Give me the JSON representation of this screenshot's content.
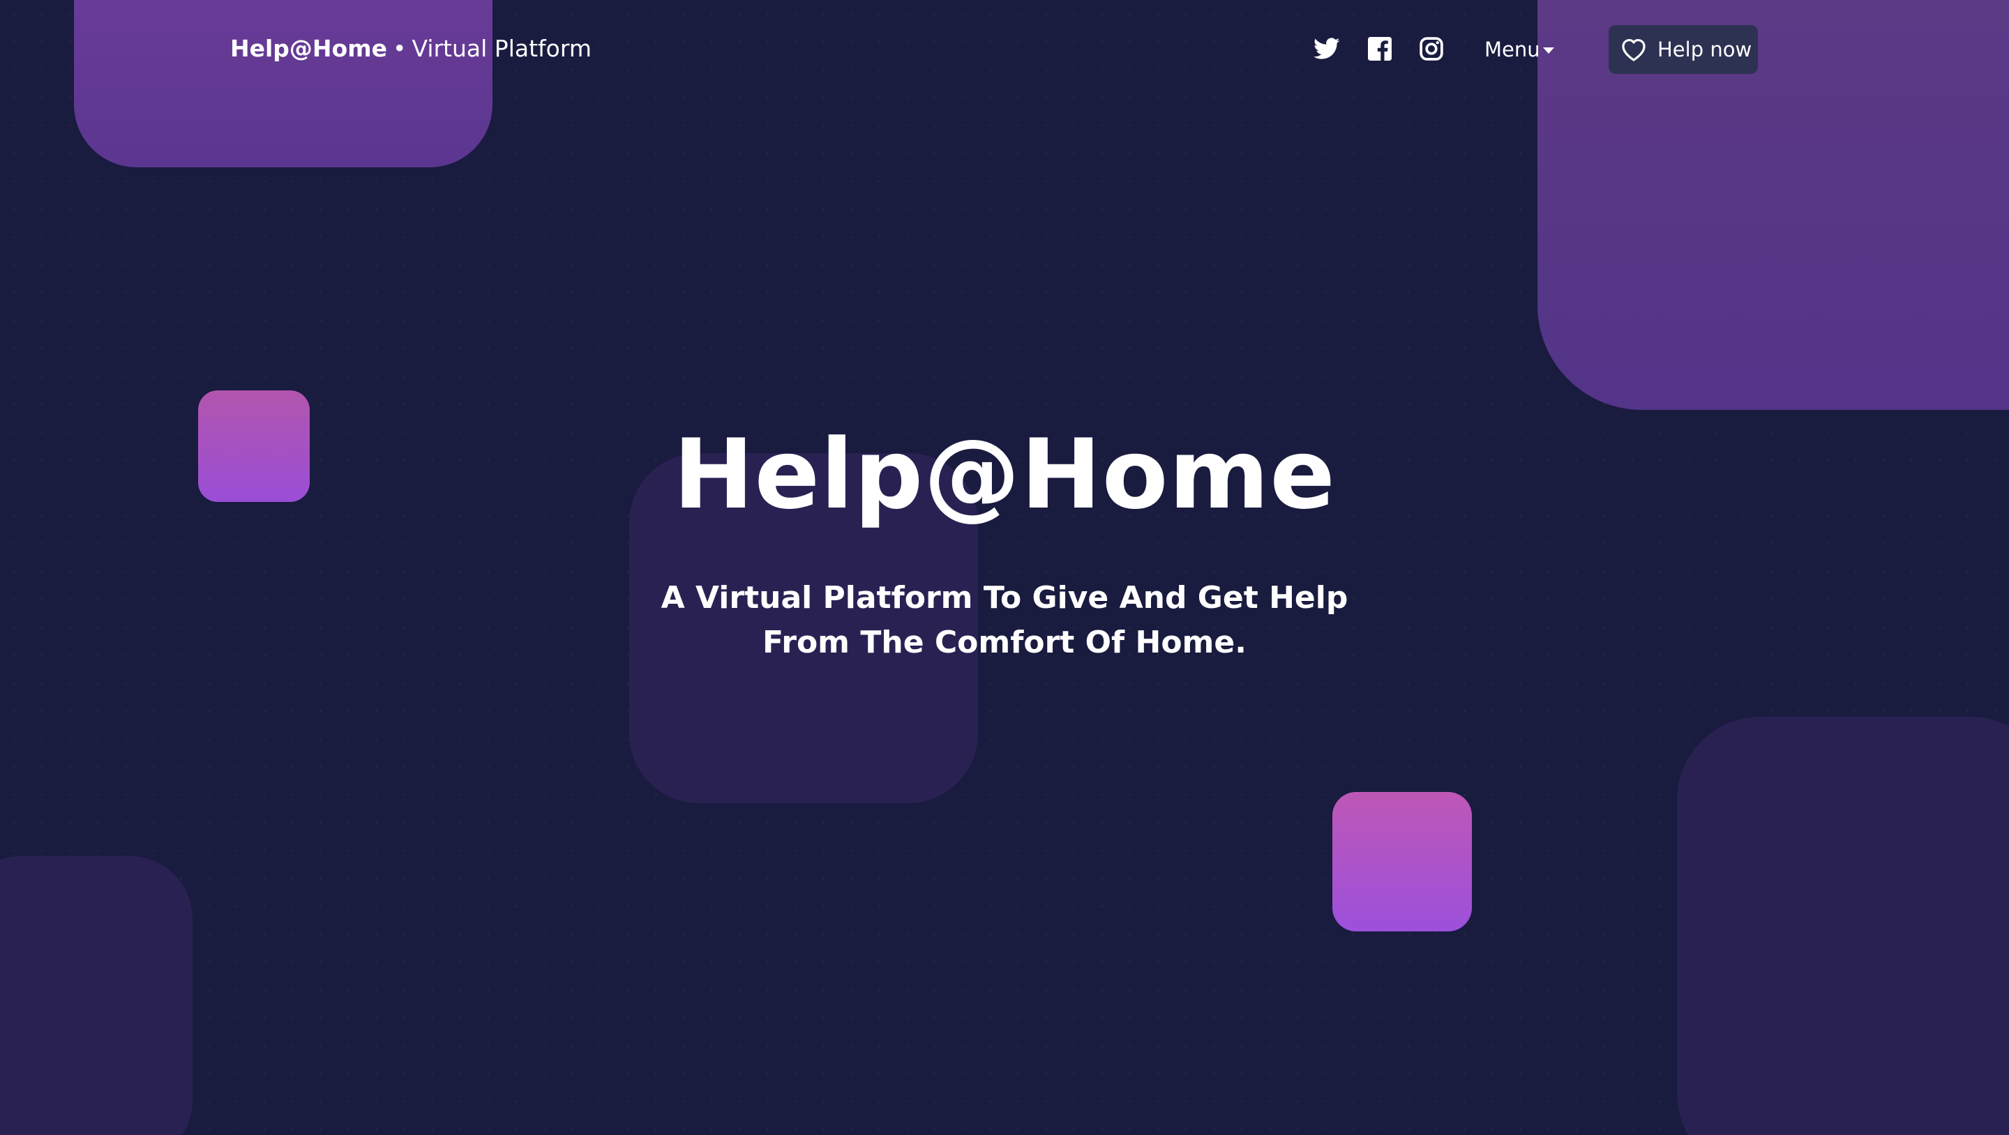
{
  "header": {
    "brand_name": "Help@Home",
    "brand_separator": "•",
    "brand_tagline": "Virtual Platform",
    "social": [
      {
        "name": "twitter",
        "icon": "twitter-icon"
      },
      {
        "name": "facebook",
        "icon": "facebook-icon"
      },
      {
        "name": "instagram",
        "icon": "instagram-icon"
      }
    ],
    "menu_label": "Menu",
    "help_button_label": "Help now",
    "help_button_icon": "heart-icon"
  },
  "hero": {
    "title": "Help@Home",
    "subtitle": "A Virtual Platform To Give And Get Help From The Comfort Of Home."
  },
  "colors": {
    "background": "#191b3f",
    "accent_purple": "#6a3c98",
    "accent_pink": "#b255ae",
    "button_bg": "#2d3252",
    "text": "#ffffff"
  }
}
